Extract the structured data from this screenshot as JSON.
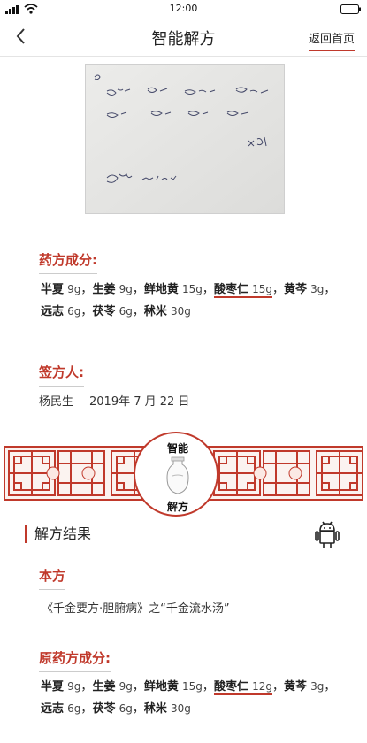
{
  "status": {
    "time": "12:00"
  },
  "nav": {
    "title": "智能解方",
    "home_label": "返回首页"
  },
  "prescription_image": {
    "alt": "手写处方照片",
    "lines": [
      "R.",
      "半夏 9g 生姜 9g 鲜地黄 15g 酸枣仁 15g",
      "黄芩 3g 远志 6g 茯苓 6g 秫米 30g",
      "×3剂",
      "2019.7.21"
    ]
  },
  "composition": {
    "title": "药方成分:",
    "herbs": [
      {
        "name": "半夏",
        "dose": "9g",
        "sep": "，"
      },
      {
        "name": "生姜",
        "dose": "9g",
        "sep": "，"
      },
      {
        "name": "鲜地黄",
        "dose": "15g",
        "sep": "，"
      },
      {
        "name": "酸枣仁",
        "dose": "15g",
        "sep": "，"
      },
      {
        "name": "黄芩",
        "dose": "3g",
        "sep": "，"
      },
      {
        "name": "远志",
        "dose": "6g",
        "sep": "，"
      },
      {
        "name": "茯苓",
        "dose": "6g",
        "sep": "，"
      },
      {
        "name": "秫米",
        "dose": "30g",
        "sep": ""
      }
    ]
  },
  "signer": {
    "title": "签方人:",
    "name": "杨民生",
    "date": "2019年 7 月 22 日"
  },
  "emblem": {
    "top": "智能",
    "bottom": "解方"
  },
  "result": {
    "title": "解方结果",
    "source_title": "本方",
    "source_text": "《千金要方·胆腑病》之“千金流水汤”",
    "original_title": "原药方成分:",
    "herbs": [
      {
        "name": "半夏",
        "dose": "9g",
        "sep": "，"
      },
      {
        "name": "生姜",
        "dose": "9g",
        "sep": "，"
      },
      {
        "name": "鲜地黄",
        "dose": "15g",
        "sep": "，"
      },
      {
        "name": "酸枣仁",
        "dose": "12g",
        "sep": "，"
      },
      {
        "name": "黄芩",
        "dose": "3g",
        "sep": "，"
      },
      {
        "name": "远志",
        "dose": "6g",
        "sep": "，"
      },
      {
        "name": "茯苓",
        "dose": "6g",
        "sep": "，"
      },
      {
        "name": "秫米",
        "dose": "30g",
        "sep": ""
      }
    ]
  },
  "colors": {
    "accent": "#c0392b"
  }
}
